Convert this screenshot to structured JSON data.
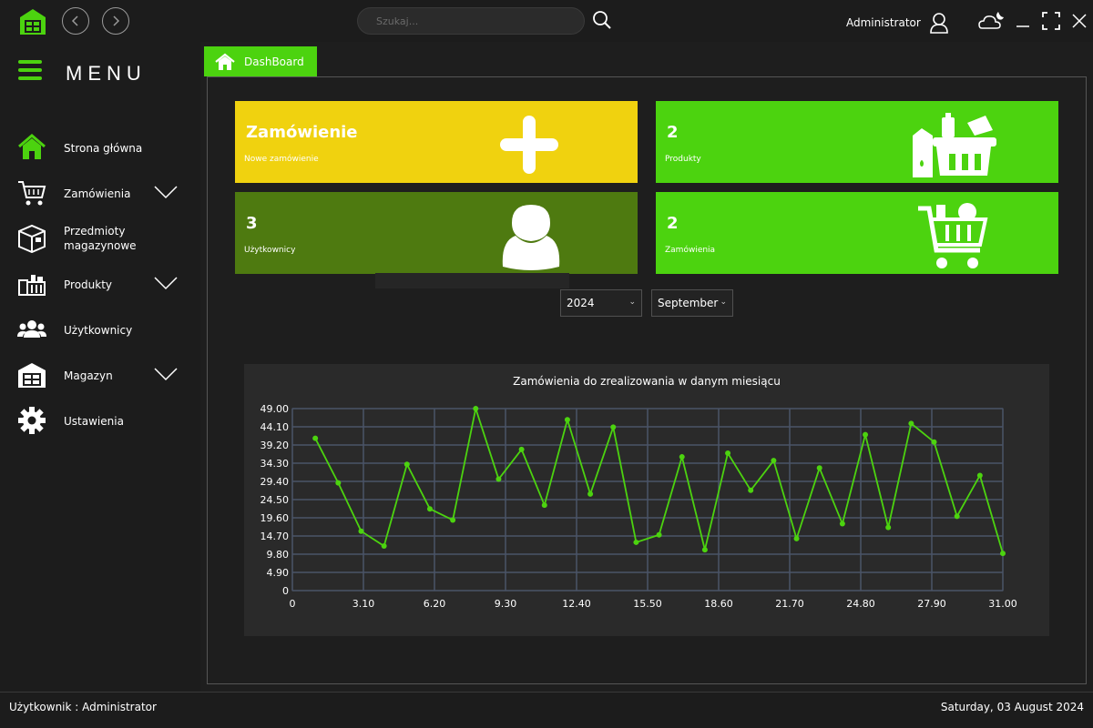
{
  "header": {
    "search_placeholder": "Szukaj...",
    "user_name": "Administrator"
  },
  "sidebar": {
    "menu_title": "MENU",
    "items": [
      {
        "label": "Strona główna",
        "icon": "home-icon",
        "expandable": false
      },
      {
        "label": "Zamówienia",
        "icon": "cart-icon",
        "expandable": true
      },
      {
        "label": "Przedmioty magazynowe",
        "icon": "box-icon",
        "expandable": false
      },
      {
        "label": "Produkty",
        "icon": "products-icon",
        "expandable": true
      },
      {
        "label": "Użytkownicy",
        "icon": "users-icon",
        "expandable": false
      },
      {
        "label": "Magazyn",
        "icon": "warehouse-icon",
        "expandable": true
      },
      {
        "label": "Ustawienia",
        "icon": "gear-icon",
        "expandable": false
      }
    ]
  },
  "tab": {
    "label": "DashBoard"
  },
  "cards": {
    "new_order": {
      "title": "Zamówienie",
      "subtitle": "Nowe zamówienie",
      "color": "#f0d20f"
    },
    "products": {
      "title": "2",
      "subtitle": "Produkty",
      "color": "#4cd30f"
    },
    "users": {
      "title": "3",
      "subtitle": "Użytkownicy",
      "color": "#4e7a10"
    },
    "orders": {
      "title": "2",
      "subtitle": "Zamówienia",
      "color": "#4cd30f"
    }
  },
  "filters": {
    "year": "2024",
    "month": "September"
  },
  "chart_data": {
    "type": "line",
    "title": "Zamówienia do zrealizowania w danym miesiącu",
    "xlabel": "",
    "ylabel": "",
    "xlim": [
      0,
      31
    ],
    "ylim": [
      0,
      49
    ],
    "x_ticks": [
      "0",
      "3.10",
      "6.20",
      "9.30",
      "12.40",
      "15.50",
      "18.60",
      "21.70",
      "24.80",
      "27.90",
      "31.00"
    ],
    "y_ticks": [
      "0",
      "4.90",
      "9.80",
      "14.70",
      "19.60",
      "24.50",
      "29.40",
      "34.30",
      "39.20",
      "44.10",
      "49.00"
    ],
    "grid": true,
    "color": "#4cd30f",
    "series": [
      {
        "x": [
          1,
          2,
          3,
          4,
          5,
          6,
          7,
          8,
          9,
          10,
          11,
          12,
          13,
          14,
          15,
          16,
          17,
          18,
          19,
          20,
          21,
          22,
          23,
          24,
          25,
          26,
          27,
          28,
          29,
          30,
          31
        ],
        "values": [
          41,
          29,
          16,
          12,
          34,
          22,
          19,
          49,
          30,
          38,
          23,
          46,
          26,
          44,
          13,
          15,
          36,
          11,
          37,
          27,
          35,
          14,
          33,
          18,
          42,
          17,
          45,
          40,
          20,
          31,
          10
        ]
      }
    ]
  },
  "status": {
    "user": "Użytkownik : Administrator",
    "date": "Saturday, 03 August 2024"
  }
}
